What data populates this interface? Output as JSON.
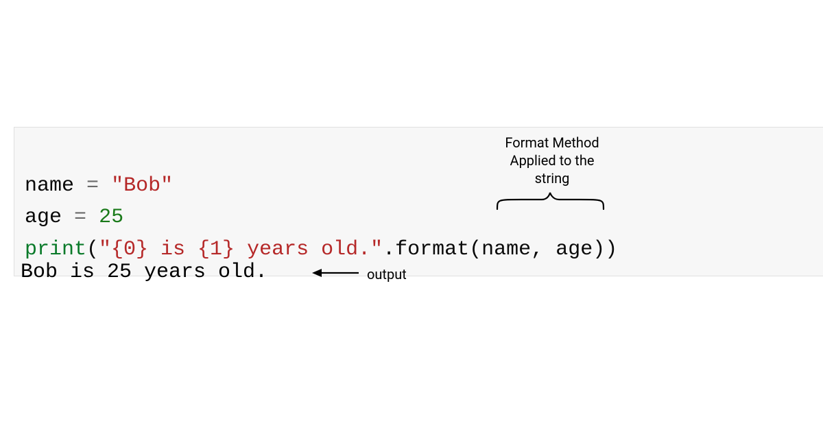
{
  "code": {
    "line1": {
      "var": "name",
      "eq": "=",
      "val_quoted": "\"Bob\""
    },
    "line2": {
      "var": "age",
      "eq": "=",
      "val": "25"
    },
    "line3": {
      "func": "print",
      "open": "(",
      "str": "\"{0} is {1} years old.\"",
      "dot": ".",
      "method": "format",
      "args_open": "(",
      "arg1": "name",
      "comma": ", ",
      "arg2": "age",
      "args_close": "))"
    }
  },
  "annotation_top": {
    "line1": "Format Method",
    "line2": "Applied to the",
    "line3": "string"
  },
  "output_text": "Bob is 25 years old.",
  "output_label": "output"
}
